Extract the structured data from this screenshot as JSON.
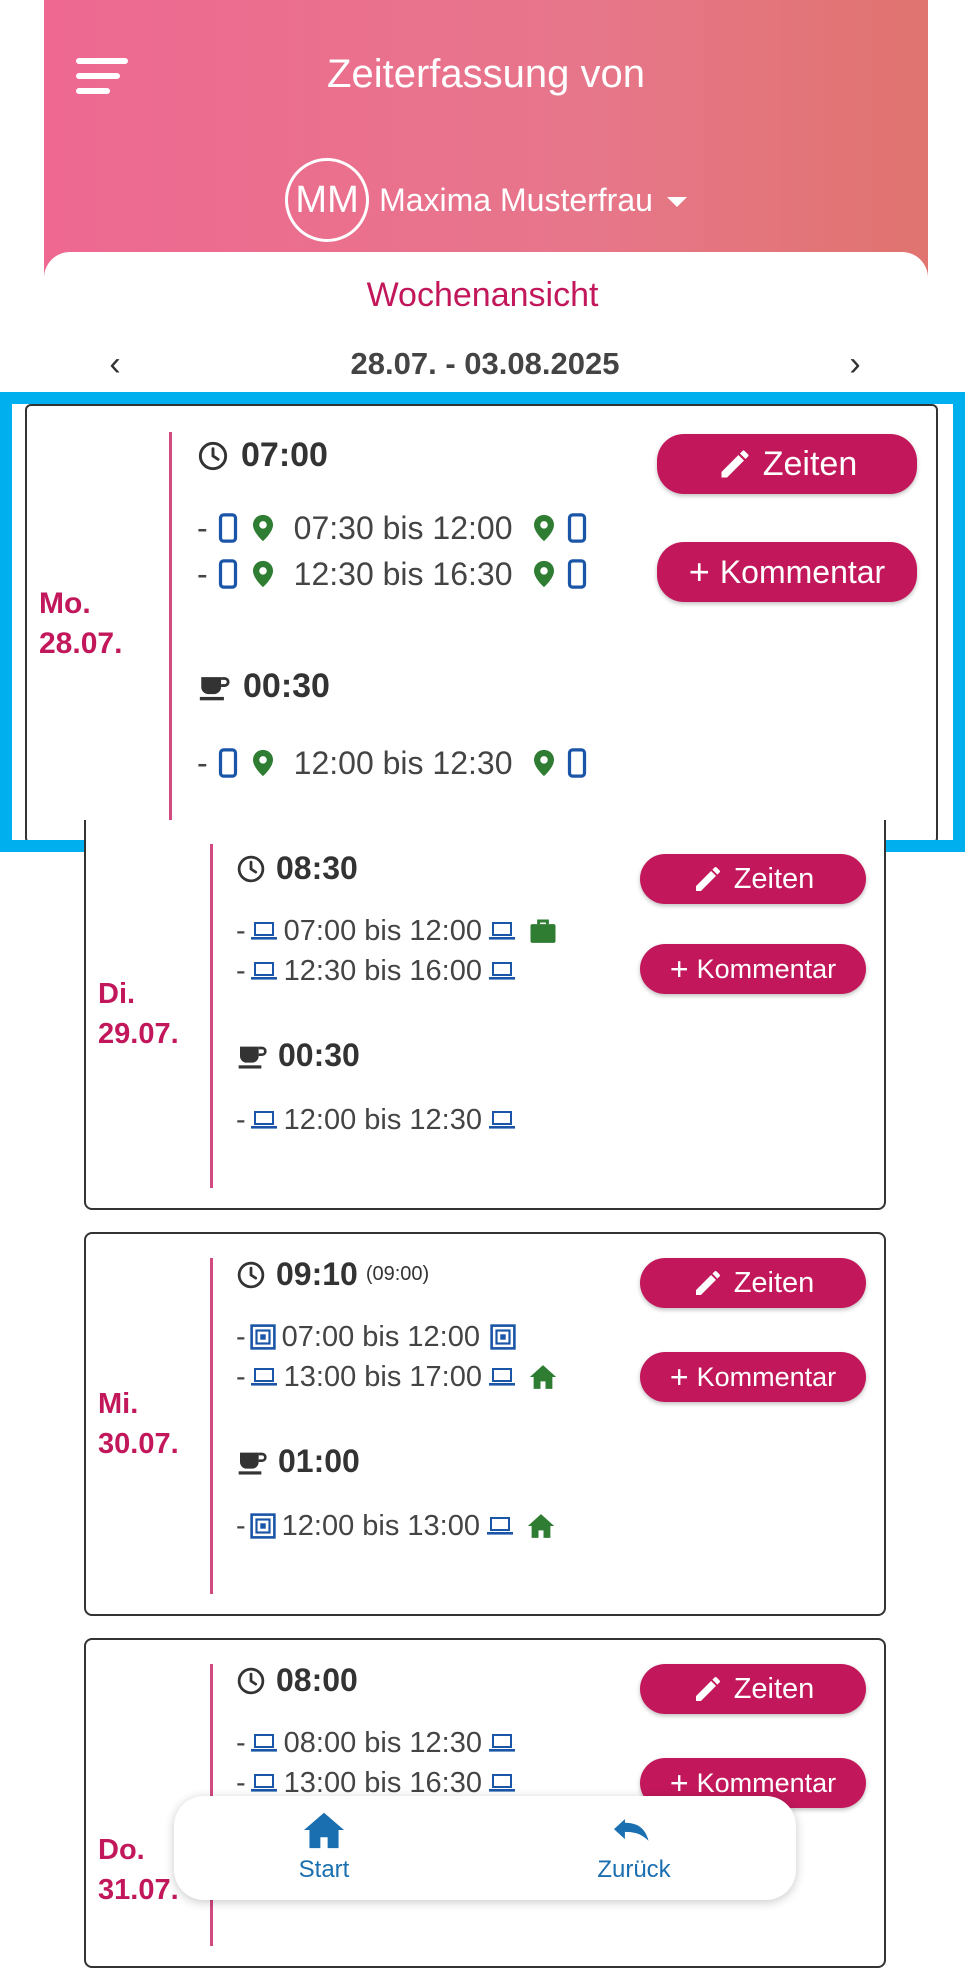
{
  "header": {
    "title": "Zeiterfassung von",
    "user_initials": "MM",
    "user_name": "Maxima Musterfrau"
  },
  "week": {
    "title": "Wochenansicht",
    "range": "28.07. - 03.08.2025",
    "prev": "‹",
    "next": "›"
  },
  "buttons": {
    "zeiten": "Zeiten",
    "kommentar": "Kommentar"
  },
  "days": [
    {
      "label_day": "Mo.",
      "label_date": "28.07.",
      "work_total": "07:00",
      "work_entries": [
        {
          "dash": "-",
          "text": "07:30 bis 12:00"
        },
        {
          "dash": "-",
          "text": "12:30 bis 16:30"
        }
      ],
      "break_total": "00:30",
      "break_entries": [
        {
          "dash": "-",
          "text": "12:00 bis 12:30"
        }
      ]
    },
    {
      "label_day": "Di.",
      "label_date": "29.07.",
      "work_total": "08:30",
      "work_entries": [
        {
          "dash": "-",
          "text": "07:00 bis 12:00"
        },
        {
          "dash": "-",
          "text": "12:30 bis 16:00"
        }
      ],
      "break_total": "00:30",
      "break_entries": [
        {
          "dash": "-",
          "text": "12:00 bis 12:30"
        }
      ]
    },
    {
      "label_day": "Mi.",
      "label_date": "30.07.",
      "work_total": "09:10",
      "work_target": "(09:00)",
      "work_entries": [
        {
          "dash": "-",
          "text": "07:00 bis 12:00"
        },
        {
          "dash": "-",
          "text": "13:00 bis 17:00"
        }
      ],
      "break_total": "01:00",
      "break_entries": [
        {
          "dash": "-",
          "text": "12:00 bis 13:00"
        }
      ]
    },
    {
      "label_day": "Do.",
      "label_date": "31.07.",
      "work_total": "08:00",
      "work_entries": [
        {
          "dash": "-",
          "text": "08:00 bis 12:30"
        },
        {
          "dash": "-",
          "text": "13:00 bis 16:30"
        }
      ]
    }
  ],
  "bottom_nav": {
    "start": "Start",
    "back": "Zurück"
  },
  "colors": {
    "accent": "#c2185b",
    "highlight": "#00b0ee",
    "icon_blue": "#1a55a8",
    "icon_green": "#2e7d32"
  }
}
